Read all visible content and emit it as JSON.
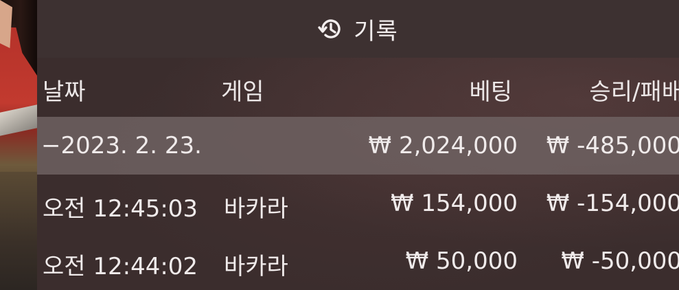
{
  "header": {
    "title": "기록",
    "icon": "history-icon"
  },
  "columns": {
    "date": "날짜",
    "game": "게임",
    "bet": "베팅",
    "result": "승리/패배"
  },
  "date_group": {
    "label": "−2023. 2. 23.",
    "bet": "₩ 2,024,000",
    "result": "₩ -485,000"
  },
  "rows": [
    {
      "time": "오전 12:45:03",
      "game": "바카라",
      "bet": "₩ 154,000",
      "result": "₩ -154,000"
    },
    {
      "time": "오전 12:44:02",
      "game": "바카라",
      "bet": "₩ 50,000",
      "result": "₩ -50,000"
    }
  ],
  "colors": {
    "panel": "#3d3131",
    "date_row": "#6e6262",
    "text": "#f0ebeb"
  }
}
